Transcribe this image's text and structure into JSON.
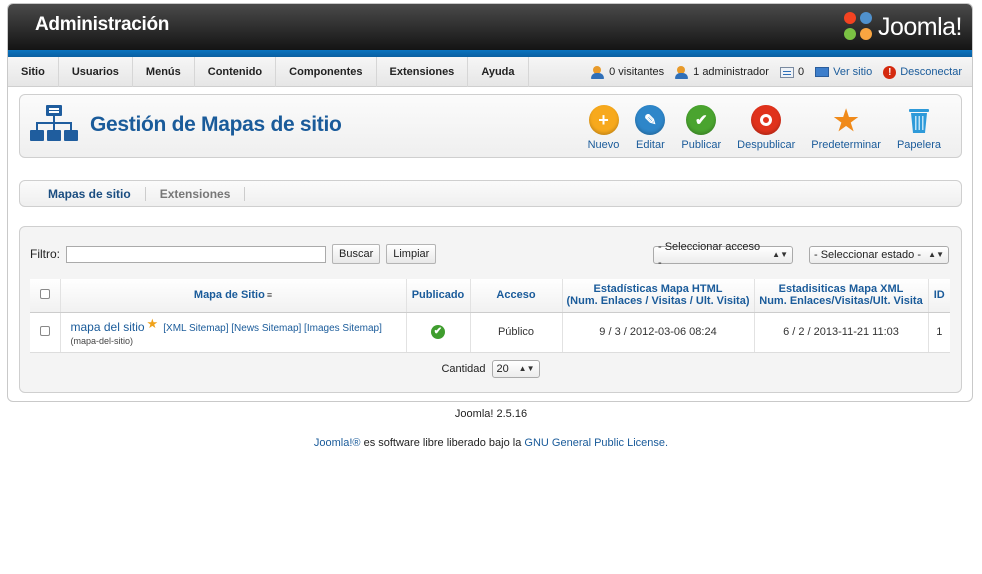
{
  "header": {
    "title": "Administración",
    "logo_text": "Joomla!"
  },
  "menu": [
    "Sitio",
    "Usuarios",
    "Menús",
    "Contenido",
    "Componentes",
    "Extensiones",
    "Ayuda"
  ],
  "status": {
    "visitors": "0 visitantes",
    "admins": "1 administrador",
    "messages": "0",
    "view_site": "Ver sitio",
    "logout": "Desconectar"
  },
  "page": {
    "title": "Gestión de Mapas de sitio"
  },
  "toolbar": [
    {
      "label": "Nuevo",
      "icon": "plus-icon",
      "color": "#f7a91d"
    },
    {
      "label": "Editar",
      "icon": "pencil-icon",
      "color": "#2e86c9"
    },
    {
      "label": "Publicar",
      "icon": "check-icon",
      "color": "#4aa42f"
    },
    {
      "label": "Despublicar",
      "icon": "unpublish-icon",
      "color": "#e0321c"
    },
    {
      "label": "Predeterminar",
      "icon": "star-icon",
      "color": "#f08a1a"
    },
    {
      "label": "Papelera",
      "icon": "trash-icon",
      "color": "#2e9ad9"
    }
  ],
  "subnav": {
    "tab1": "Mapas de sitio",
    "tab2": "Extensiones"
  },
  "filter": {
    "label": "Filtro:",
    "value": "",
    "search_button": "Buscar",
    "clear_button": "Limpiar",
    "access_select": "- Seleccionar acceso -",
    "state_select": "- Seleccionar estado -"
  },
  "table": {
    "headers": {
      "sitemap": "Mapa de Sitio",
      "published": "Publicado",
      "access": "Acceso",
      "html_stats_line1": "Estadísticas Mapa HTML",
      "html_stats_line2": "(Num. Enlaces / Visitas / Ult. Visita)",
      "xml_stats_line1": "Estadisiticas Mapa XML",
      "xml_stats_line2": "Num. Enlaces/Visitas/Ult. Visita",
      "id": "ID"
    },
    "rows": [
      {
        "name": "mapa del sitio",
        "links": "[XML Sitemap] [News Sitemap] [Images Sitemap]",
        "alias": "(mapa-del-sitio)",
        "access": "Público",
        "html_stats": "9 / 3 / 2012-03-06 08:24",
        "xml_stats": "6 / 2 / 2013-11-21 11:03",
        "id": "1"
      }
    ]
  },
  "pagination": {
    "label": "Cantidad",
    "limit": "20"
  },
  "footer": {
    "version": "Joomla! 2.5.16",
    "license_brand": "Joomla!®",
    "license_text": " es software libre liberado bajo la ",
    "license_link": "GNU General Public License."
  }
}
